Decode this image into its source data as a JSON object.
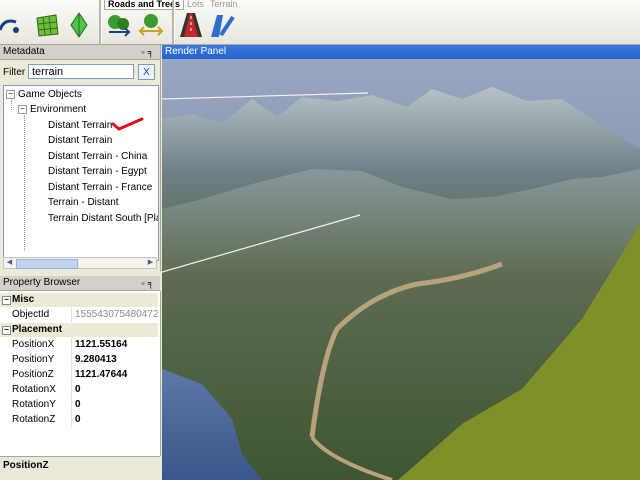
{
  "toolbar": {
    "tabs": [
      "Roads and Trees",
      "Lots",
      "Terrain"
    ]
  },
  "metadata": {
    "title": "Metadata",
    "filter_label": "Filter",
    "filter_value": "terrain",
    "clear_label": "X",
    "tree": {
      "root": "Game Objects",
      "group": "Environment",
      "items": [
        "Distant Terrain",
        "Distant Terrain",
        "Distant Terrain - China",
        "Distant Terrain - Egypt",
        "Distant Terrain - France",
        "Terrain - Distant",
        "Terrain Distant South [Plac"
      ]
    }
  },
  "properties": {
    "title": "Property Browser",
    "categories": {
      "misc": "Misc",
      "placement": "Placement"
    },
    "rows": [
      {
        "name": "ObjectId",
        "value": "155543075480472"
      },
      {
        "name": "PositionX",
        "value": "1121.55164"
      },
      {
        "name": "PositionY",
        "value": "9.280413"
      },
      {
        "name": "PositionZ",
        "value": "1121.47644"
      },
      {
        "name": "RotationX",
        "value": "0"
      },
      {
        "name": "RotationY",
        "value": "0"
      },
      {
        "name": "RotationZ",
        "value": "0"
      }
    ]
  },
  "status": {
    "selected_property": "PositionZ"
  },
  "render_panel": {
    "title": "Render Panel"
  },
  "colors": {
    "accent": "#2562c9",
    "annotation": "#e0101c",
    "ground": "#7f9028"
  }
}
